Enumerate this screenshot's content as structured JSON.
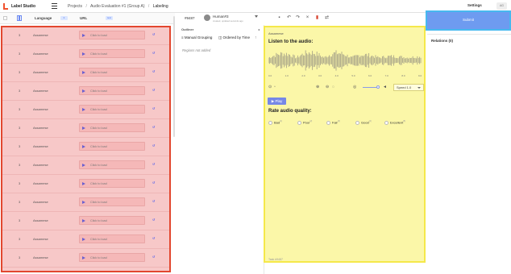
{
  "app": {
    "logo_text": "Label Studio",
    "breadcrumbs": [
      "Projects",
      "Audio Evaluation #1 (Group A)",
      "Labeling"
    ],
    "settings_label": "Settings",
    "user_initials": "AG"
  },
  "task_list": {
    "columns": {
      "language": "Language",
      "url": "URL"
    },
    "column_badges": {
      "language": "tt",
      "url": "text"
    },
    "rows": [
      {
        "id": "3",
        "language": "Assamese",
        "audio_label": "Click to load",
        "mark": "↺"
      },
      {
        "id": "3",
        "language": "Assamese",
        "audio_label": "Click to load",
        "mark": "↺"
      },
      {
        "id": "3",
        "language": "Assamese",
        "audio_label": "Click to load",
        "mark": "↺"
      },
      {
        "id": "3",
        "language": "Assamese",
        "audio_label": "Click to load",
        "mark": "↺"
      },
      {
        "id": "3",
        "language": "Assamese",
        "audio_label": "Click to load",
        "mark": "↺"
      },
      {
        "id": "3",
        "language": "Assamese",
        "audio_label": "Click to load",
        "mark": "↺"
      },
      {
        "id": "3",
        "language": "Assamese",
        "audio_label": "Click to load",
        "mark": "↺"
      },
      {
        "id": "3",
        "language": "Assamese",
        "audio_label": "Click to load",
        "mark": "↺"
      },
      {
        "id": "3",
        "language": "Assamese",
        "audio_label": "Click to load",
        "mark": "↺"
      },
      {
        "id": "3",
        "language": "Assamese",
        "audio_label": "Click to load",
        "mark": "↺"
      },
      {
        "id": "3",
        "language": "Assamese",
        "audio_label": "Click to load",
        "mark": "↺"
      },
      {
        "id": "3",
        "language": "Assamese",
        "audio_label": "Click to load",
        "mark": "↺"
      },
      {
        "id": "3",
        "language": "Assamese",
        "audio_label": "Click to load",
        "mark": "↺"
      }
    ]
  },
  "annotation": {
    "task_id": "#9487",
    "annotator_name": "Human#3",
    "annotator_sub": "created, updated seconds ago",
    "outliner_label": "Outliner",
    "group_label": "Manual Grouping",
    "order_label": "Ordered by Time",
    "no_regions": "Regions not added"
  },
  "editor": {
    "heading": "Assamese",
    "listen_title": "Listen to the audio:",
    "timeline": [
      "0.0",
      "1.0",
      "2.0",
      "3.0",
      "4.0",
      "5.0",
      "6.0",
      "7.0",
      "8.0",
      "9.0"
    ],
    "speed_label": "Speed 1.0",
    "play_label": "Play",
    "rate_title": "Rate audio quality:",
    "choices": [
      {
        "label": "Bad",
        "hotkey": "[1]"
      },
      {
        "label": "Poor",
        "hotkey": "[2]"
      },
      {
        "label": "Fair",
        "hotkey": "[3]"
      },
      {
        "label": "Good",
        "hotkey": "[4]"
      },
      {
        "label": "Excellent",
        "hotkey": "[5]"
      }
    ],
    "footer": "Task #9487"
  },
  "right_panel": {
    "submit_label": "Submit",
    "relations_label": "Relations (0)"
  },
  "colors": {
    "accent": "#7688e6",
    "list_highlight": "#f7c8c8",
    "list_border": "#e2472f",
    "editor_highlight": "#fbf7a8",
    "editor_border": "#f5e84a",
    "submit_bg": "#6e9bf0",
    "submit_border": "#47b8ef"
  }
}
